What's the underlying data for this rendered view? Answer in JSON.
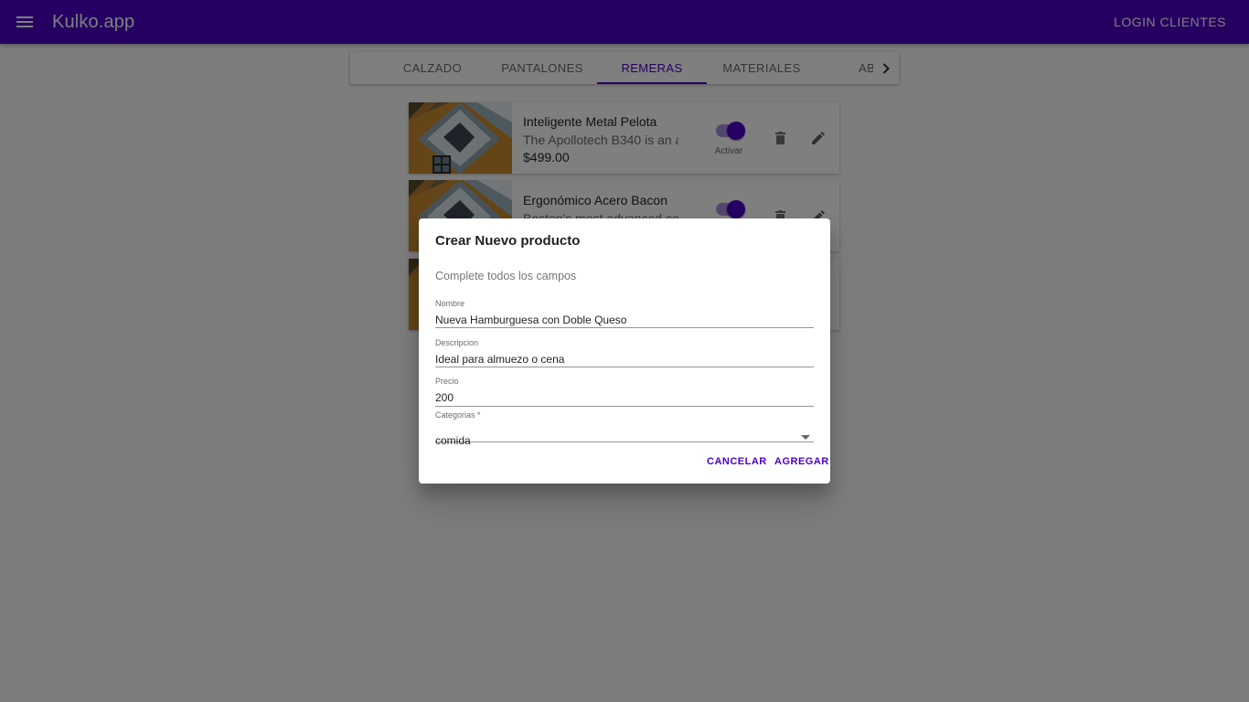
{
  "app": {
    "title": "Kulko.app",
    "login_label": "LOGIN CLIENTES",
    "accent_color": "#4a00c4"
  },
  "tabs": [
    {
      "label": "CALZADO",
      "active": false
    },
    {
      "label": "PANTALONES",
      "active": false
    },
    {
      "label": "REMERAS",
      "active": true
    },
    {
      "label": "MATERIALES",
      "active": false
    },
    {
      "label": "ABR",
      "active": false
    }
  ],
  "products": [
    {
      "title": "Inteligente Metal Pelota",
      "description": "The Apollotech B340 is an a...",
      "price": "$499.00",
      "toggle_label": "Activar",
      "active": true
    },
    {
      "title": "Ergonómico Acero Bacon",
      "description": "Boston's most advanced comp...",
      "price": "",
      "toggle_label": "",
      "active": true
    },
    {
      "title": "",
      "description": "",
      "price": "",
      "toggle_label": "",
      "active": true
    }
  ],
  "dialog": {
    "title": "Crear Nuevo producto",
    "subtitle": "Complete todos los campos",
    "fields": {
      "nombre": {
        "label": "Nombre",
        "value": "Nueva Hamburguesa con Doble Queso"
      },
      "descripcion": {
        "label": "Descripcion",
        "value": "Ideal para almuezo o cena"
      },
      "precio": {
        "label": "Precio",
        "value": "200"
      },
      "categorias": {
        "label": "Categorias *",
        "value": "comida"
      }
    },
    "cancel_label": "CANCELAR",
    "add_label": "AGREGAR"
  },
  "icons": [
    "menu-icon",
    "chevron-right-icon",
    "delete-icon",
    "edit-icon",
    "dropdown-arrow-icon"
  ]
}
